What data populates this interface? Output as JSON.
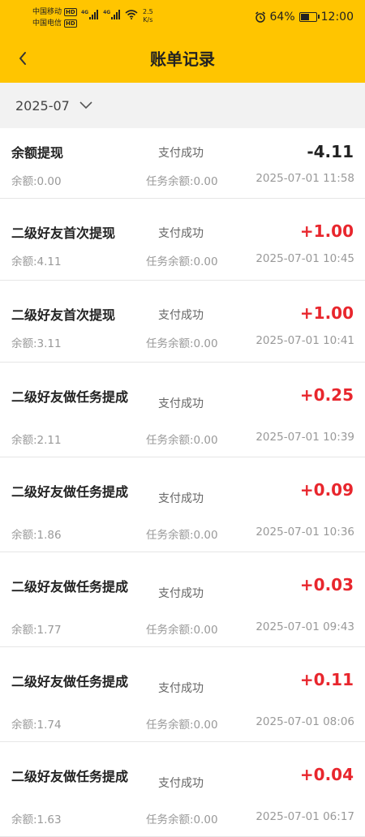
{
  "status_bar": {
    "carrier1": "中国移动",
    "carrier2": "中国电信",
    "hd1": "HD",
    "hd2": "HD",
    "net1": "4G",
    "net2": "4G",
    "speed_value": "2.5",
    "speed_unit": "K/s",
    "battery": "64%",
    "battery_level": 0.64,
    "time": "12:00"
  },
  "header": {
    "title": "账单记录"
  },
  "filter": {
    "month": "2025-07"
  },
  "colors": {
    "accent": "#ffc500",
    "positive": "#e8262d",
    "negative": "#222222"
  },
  "records": [
    {
      "name": "余额提现",
      "status": "支付成功",
      "amount": "-4.11",
      "balance": "余额:0.00",
      "task_balance": "任务余额:0.00",
      "time": "2025-07-01 11:58"
    },
    {
      "name": "二级好友首次提现",
      "status": "支付成功",
      "amount": "+1.00",
      "balance": "余额:4.11",
      "task_balance": "任务余额:0.00",
      "time": "2025-07-01 10:45"
    },
    {
      "name": "二级好友首次提现",
      "status": "支付成功",
      "amount": "+1.00",
      "balance": "余额:3.11",
      "task_balance": "任务余额:0.00",
      "time": "2025-07-01 10:41"
    },
    {
      "name": "二级好友做任务提成",
      "status": "支付成功",
      "amount": "+0.25",
      "balance": "余额:2.11",
      "task_balance": "任务余额:0.00",
      "time": "2025-07-01 10:39"
    },
    {
      "name": "二级好友做任务提成",
      "status": "支付成功",
      "amount": "+0.09",
      "balance": "余额:1.86",
      "task_balance": "任务余额:0.00",
      "time": "2025-07-01 10:36"
    },
    {
      "name": "二级好友做任务提成",
      "status": "支付成功",
      "amount": "+0.03",
      "balance": "余额:1.77",
      "task_balance": "任务余额:0.00",
      "time": "2025-07-01 09:43"
    },
    {
      "name": "二级好友做任务提成",
      "status": "支付成功",
      "amount": "+0.11",
      "balance": "余额:1.74",
      "task_balance": "任务余额:0.00",
      "time": "2025-07-01 08:06"
    },
    {
      "name": "二级好友做任务提成",
      "status": "支付成功",
      "amount": "+0.04",
      "balance": "余额:1.63",
      "task_balance": "任务余额:0.00",
      "time": "2025-07-01 06:17"
    }
  ]
}
